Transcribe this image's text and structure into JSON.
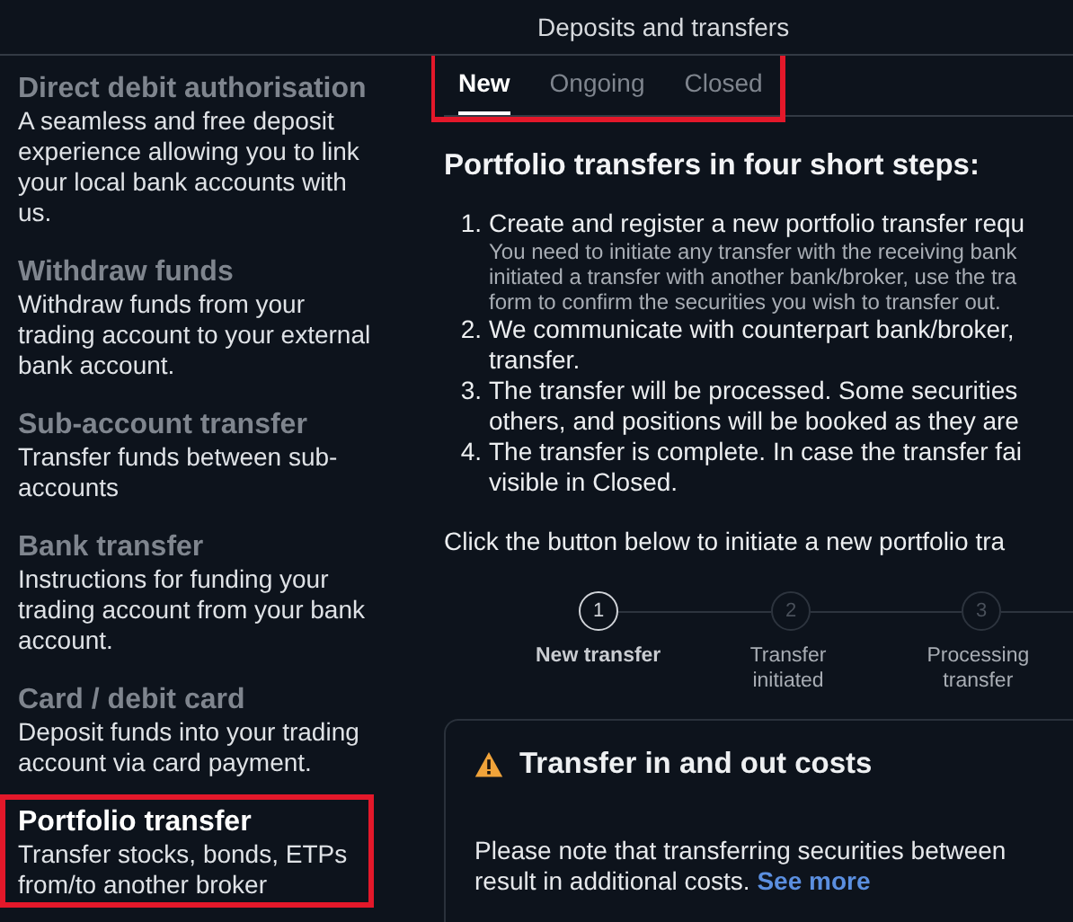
{
  "window": {
    "title": "Deposits and transfers"
  },
  "sidebar": {
    "items": [
      {
        "title": "Direct debit authorisation",
        "lines": [
          "A seamless and free deposit",
          "experience allowing you to link",
          "your local bank accounts with",
          "us."
        ],
        "selected": false,
        "highlight": false
      },
      {
        "title": "Withdraw funds",
        "lines": [
          "Withdraw funds from your",
          "trading account to your external",
          "bank account."
        ],
        "selected": false,
        "highlight": false
      },
      {
        "title": "Sub-account transfer",
        "lines": [
          "Transfer funds between sub-",
          "accounts"
        ],
        "selected": false,
        "highlight": false
      },
      {
        "title": "Bank transfer",
        "lines": [
          "Instructions for funding your",
          "trading account from your bank",
          "account."
        ],
        "selected": false,
        "highlight": false
      },
      {
        "title": "Card / debit card",
        "lines": [
          "Deposit funds into your trading",
          "account via card payment."
        ],
        "selected": false,
        "highlight": false
      },
      {
        "title": "Portfolio transfer",
        "lines": [
          "Transfer stocks, bonds, ETPs",
          "from/to another broker"
        ],
        "selected": true,
        "highlight": true
      }
    ]
  },
  "tab_bar": {
    "highlight": true,
    "tabs": [
      {
        "label": "New",
        "selected": true
      },
      {
        "label": "Ongoing",
        "selected": false
      },
      {
        "label": "Closed",
        "selected": false
      }
    ]
  },
  "heading": "Portfolio transfers in four short steps:",
  "steps": [
    {
      "number": "1.",
      "lines": [
        "Create and register a new portfolio transfer requ"
      ],
      "note_lines": [
        "You need to initiate any transfer with the receiving bank",
        "initiated a transfer with another bank/broker, use the tra",
        "form to confirm the securities you wish to transfer out."
      ]
    },
    {
      "number": "2.",
      "lines": [
        "We communicate with counterpart bank/broker,",
        "transfer."
      ]
    },
    {
      "number": "3.",
      "lines": [
        "The transfer will be processed. Some securities",
        "others, and positions will be booked as they are"
      ]
    },
    {
      "number": "4.",
      "lines": [
        "The transfer is complete. In case the transfer fai",
        "visible in Closed."
      ]
    }
  ],
  "instruction": "Click the button below to initiate a new portfolio tra",
  "stepper": [
    {
      "number": "1",
      "label": "New transfer",
      "selected": true
    },
    {
      "number": "2",
      "label": "Transfer initiated",
      "selected": false
    },
    {
      "number": "3",
      "label": "Processing transfer",
      "selected": false
    }
  ],
  "notice": {
    "title": "Transfer in and out costs",
    "lines": [
      "Please note that transferring securities between",
      "result in additional costs."
    ],
    "link": "See more"
  }
}
